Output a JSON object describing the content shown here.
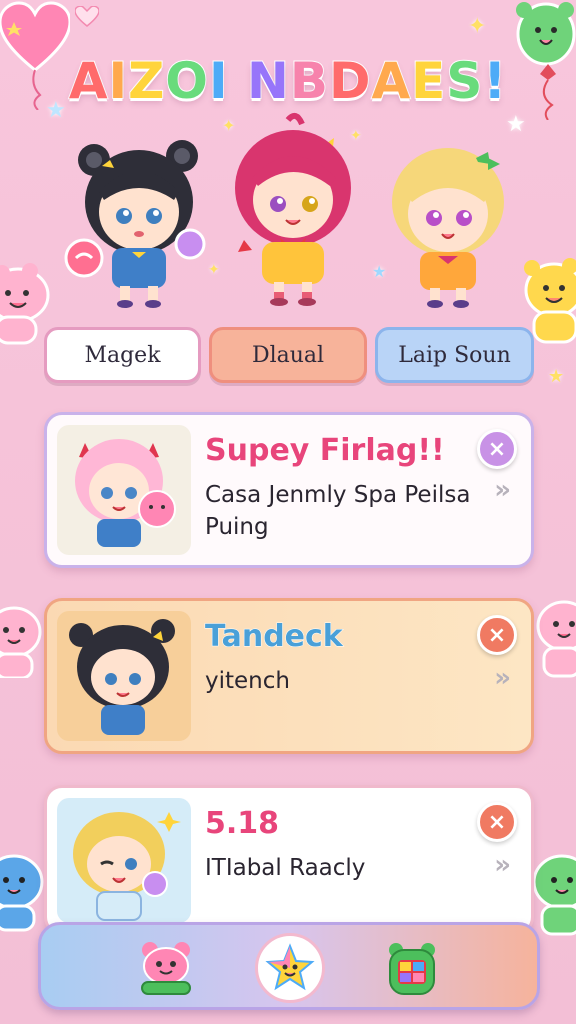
{
  "app": {
    "title": "AIZOI NBDAES!",
    "title_colors": [
      "#ff6b6b",
      "#ffa94d",
      "#ffd43b",
      "#69db7c",
      "#4dabf7",
      "#9775fa",
      "#f783ac"
    ]
  },
  "tabs": [
    {
      "label": "Magek",
      "icon": "none"
    },
    {
      "label": "Dlaual",
      "icon": "none"
    },
    {
      "label": "Laip Soun",
      "icon": "none"
    }
  ],
  "cards": [
    {
      "title": "Supey Firlag!!",
      "subtitle": "Casa Jenmly Spa Peilsa Puing",
      "thumbnail": "pink-haired-girl-with-plush",
      "close_icon": "close-icon",
      "chevron_icon": "double-chevron-right-icon",
      "accent": "#e8457b"
    },
    {
      "title": "Tandeck",
      "subtitle": "yitench",
      "thumbnail": "dark-haired-bear-ear-girl",
      "close_icon": "close-icon",
      "chevron_icon": "double-chevron-right-icon",
      "accent": "#4aa0d8"
    },
    {
      "title": "5.18",
      "subtitle": "ITIabal Raacly",
      "thumbnail": "blonde-winking-girl",
      "close_icon": "close-icon",
      "chevron_icon": "double-chevron-right-icon",
      "accent": "#e8457b"
    }
  ],
  "bottom_nav": [
    {
      "icon": "bear-home-icon",
      "active": false
    },
    {
      "icon": "star-face-icon",
      "active": true
    },
    {
      "icon": "backpack-icon",
      "active": false
    }
  ],
  "icons": {
    "close": "×",
    "chevron": "»"
  }
}
